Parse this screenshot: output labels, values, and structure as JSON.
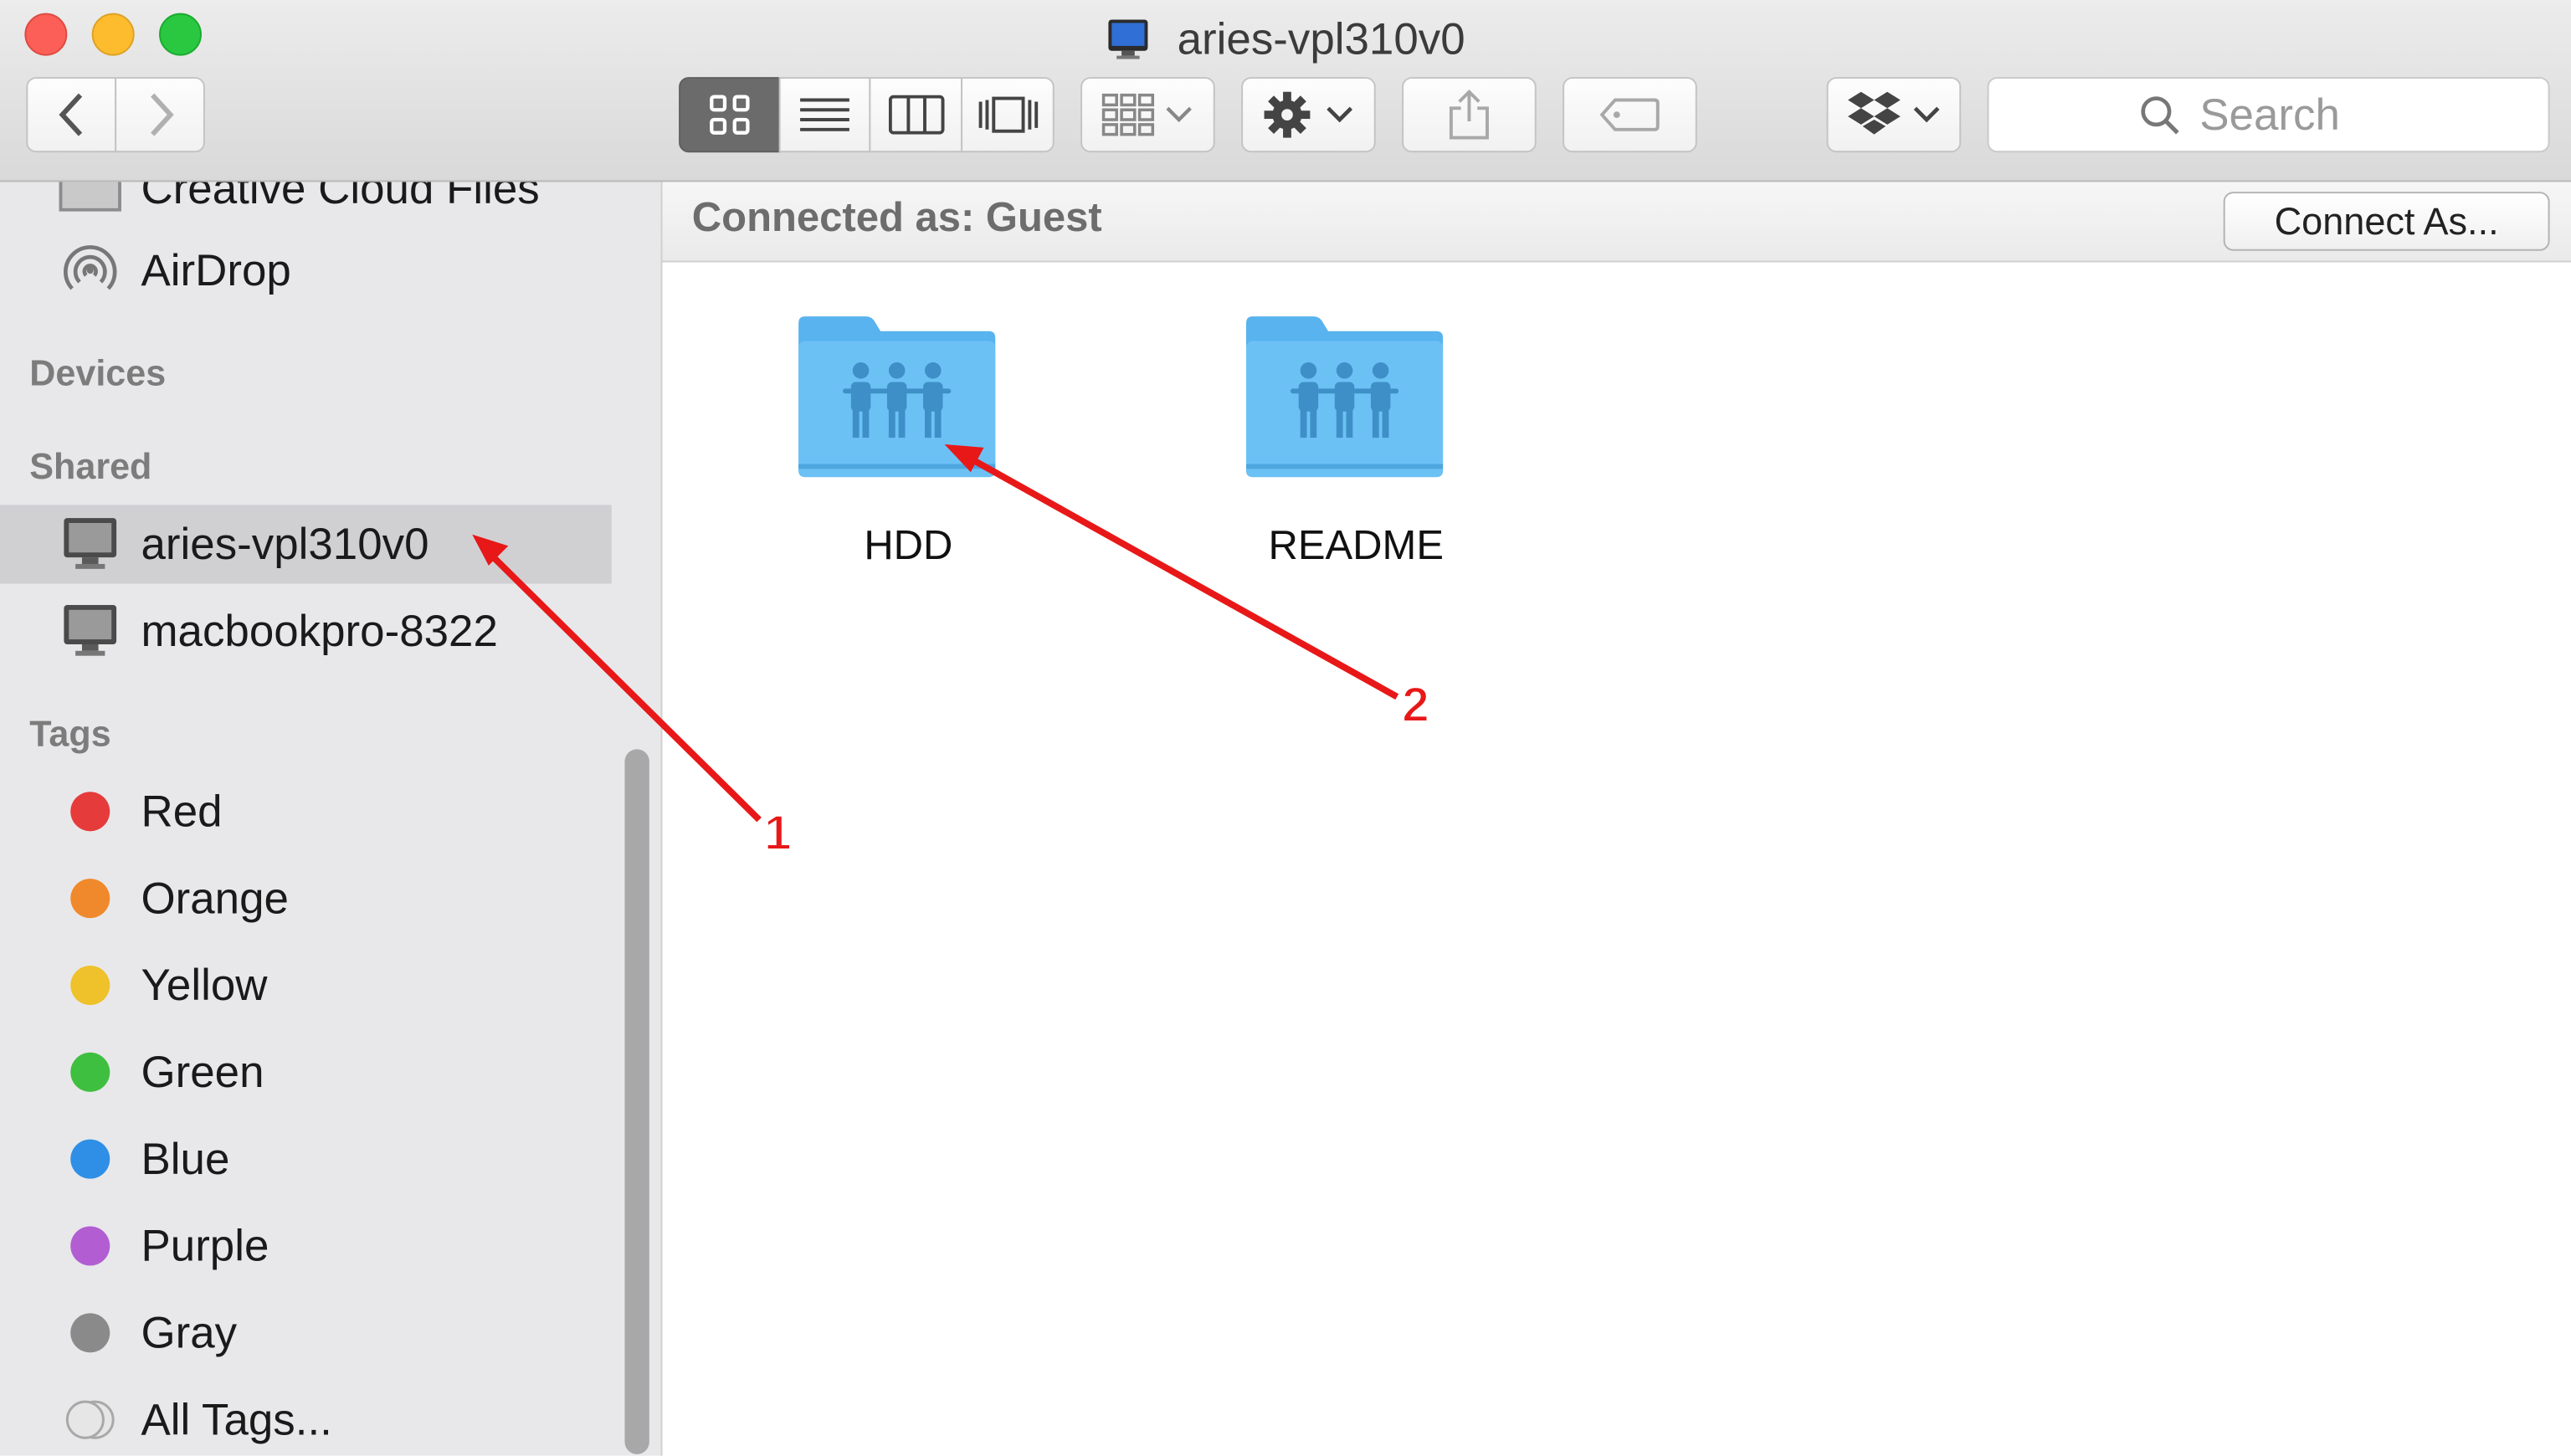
{
  "window": {
    "title": "aries-vpl310v0"
  },
  "toolbar": {
    "back_icon": "chevron-left-icon",
    "forward_icon": "chevron-right-icon",
    "views": [
      "icon-view-icon",
      "list-view-icon",
      "column-view-icon",
      "coverflow-view-icon"
    ],
    "search_placeholder": "Search"
  },
  "sidebar": {
    "partial_item": "Creative Cloud Files",
    "airdrop": "AirDrop",
    "devices_header": "Devices",
    "shared_header": "Shared",
    "shared_items": [
      "aries-vpl310v0",
      "macbookpro-8322"
    ],
    "tags_header": "Tags",
    "tags": [
      {
        "label": "Red",
        "color": "#e63b3b"
      },
      {
        "label": "Orange",
        "color": "#f0892b"
      },
      {
        "label": "Yellow",
        "color": "#efc12a"
      },
      {
        "label": "Green",
        "color": "#3fbf3f"
      },
      {
        "label": "Blue",
        "color": "#2f8fe6"
      },
      {
        "label": "Purple",
        "color": "#b25ed2"
      },
      {
        "label": "Gray",
        "color": "#8a8a8a"
      }
    ],
    "all_tags": "All Tags..."
  },
  "content": {
    "connected_as": "Connected as: Guest",
    "connect_button": "Connect As...",
    "folders": [
      "HDD",
      "README"
    ]
  },
  "annotations": {
    "labels": [
      "1",
      "2"
    ],
    "color": "#e81818"
  }
}
